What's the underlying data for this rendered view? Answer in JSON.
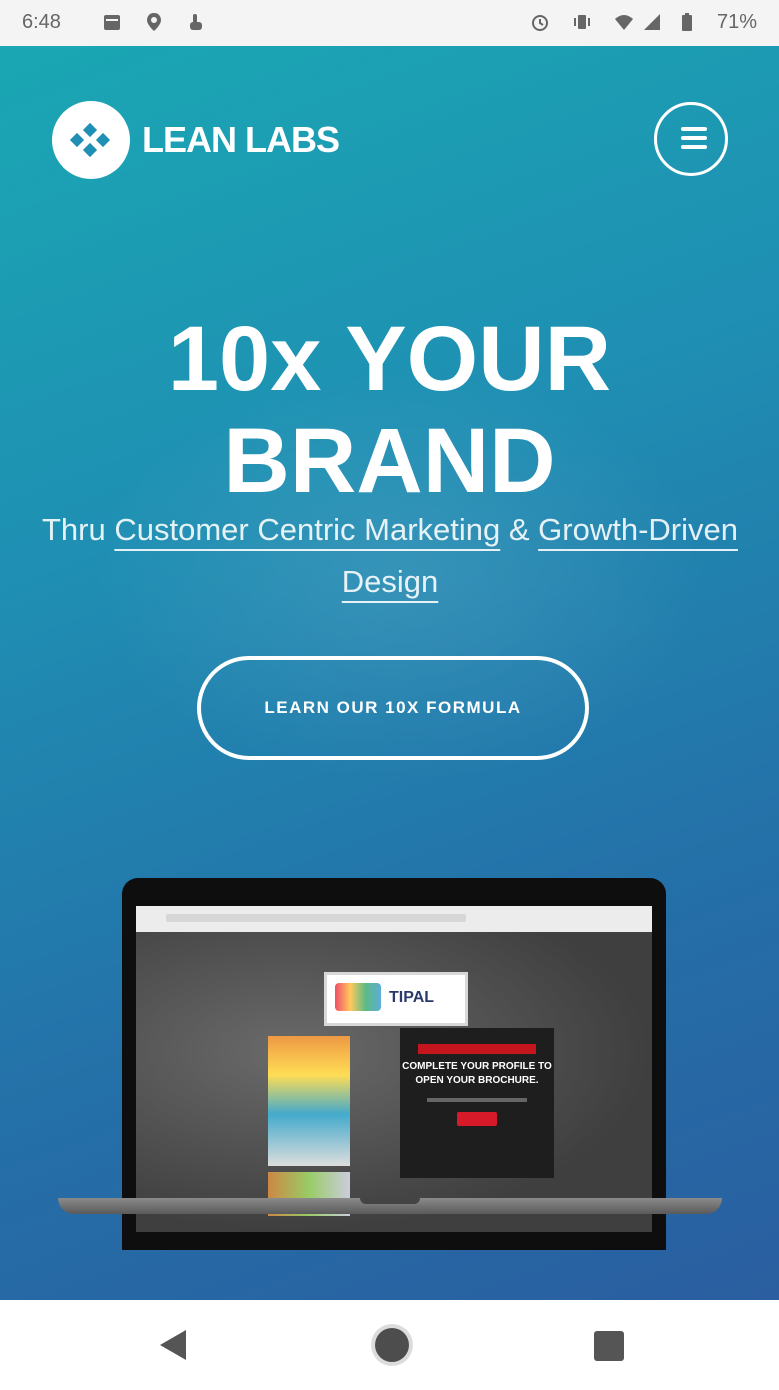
{
  "status_bar": {
    "time": "6:48",
    "battery": "71%",
    "icons": [
      "calendar-icon",
      "location-icon",
      "touch-icon",
      "alarm-icon",
      "vibrate-icon",
      "wifi-icon",
      "signal-icon",
      "battery-icon"
    ]
  },
  "header": {
    "logo_text": "LEAN LABS",
    "menu_icon": "hamburger-icon"
  },
  "hero": {
    "headline_line1": "10x YOUR",
    "headline_line2": "BRAND",
    "subline_prefix": "Thru ",
    "subline_link1": "Customer Centric Marketing",
    "subline_amp": " & ",
    "subline_link2": "Growth-Driven",
    "subline_link3": "Design",
    "cta_label": "LEARN OUR 10X FORMULA"
  },
  "laptop_preview": {
    "promo_lines": "COMPLETE YOUR PROFILE TO OPEN YOUR BROCHURE."
  },
  "nav_bar": {
    "icons": [
      "back-icon",
      "home-icon",
      "recents-icon"
    ]
  },
  "colors": {
    "gradient_top": "#1aa7b3",
    "gradient_bottom": "#2a5ea0",
    "accent_red": "#d71a2a"
  }
}
